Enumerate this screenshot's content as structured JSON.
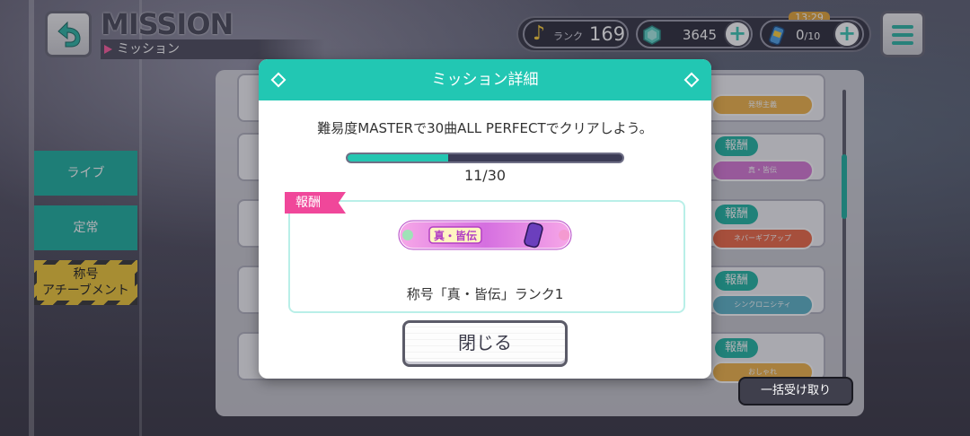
{
  "header": {
    "title": "MISSION",
    "subtitle": "ミッション"
  },
  "status": {
    "rank_label": "ランク",
    "rank_value": "169",
    "crystal_value": "3645",
    "energy_value": "0",
    "energy_max": "/10",
    "timer": "13:29"
  },
  "nav": {
    "items": [
      {
        "label": "ライブ"
      },
      {
        "label": "定常"
      },
      {
        "label": "称号\nアチーブメント",
        "line1": "称号",
        "line2": "アチーブメント"
      }
    ]
  },
  "list": {
    "reward_tag": "報酬",
    "chips": [
      "発想主義",
      "真・皆伝",
      "ネバーギブアップ",
      "シンクロニシティ",
      "おしゃれ"
    ],
    "bulk_receive_label": "一括受け取り"
  },
  "modal": {
    "title": "ミッション詳細",
    "mission_text": "難易度MASTERで30曲ALL PERFECTでクリアしよう。",
    "progress_current": 11,
    "progress_total": 30,
    "progress_text": "11/30",
    "reward_tag": "報酬",
    "reward_badge_text": "真・皆伝",
    "reward_caption": "称号「真・皆伝」ランク1",
    "close_label": "閉じる"
  },
  "colors": {
    "accent": "#22c7b3",
    "reward_pink": "#f0479a",
    "progress_bg": "#3c3c56"
  },
  "icons": [
    "back-arrow-icon",
    "music-note-icon",
    "crystal-icon",
    "energy-drink-icon",
    "plus-icon",
    "hamburger-menu-icon",
    "diamond-icon"
  ]
}
